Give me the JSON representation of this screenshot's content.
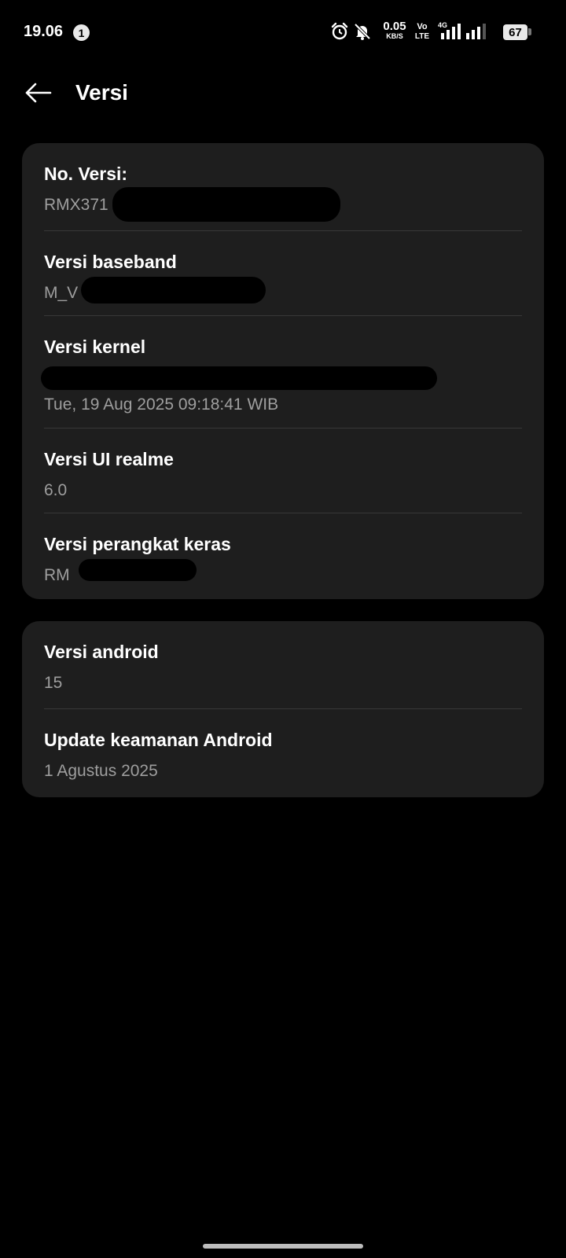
{
  "status_bar": {
    "time": "19.06",
    "notification_count": "1",
    "net_speed_value": "0.05",
    "net_speed_unit": "KB/S",
    "volte_top": "Vo",
    "volte_bottom": "LTE",
    "network_type": "4G",
    "battery_level": "67"
  },
  "header": {
    "title": "Versi"
  },
  "sections": [
    {
      "items": [
        {
          "label": "No. Versi:",
          "value": "RMX371"
        },
        {
          "label": "Versi baseband",
          "value": "M_V"
        },
        {
          "label": "Versi kernel",
          "value": "Tue, 19 Aug 2025 09:18:41 WIB"
        },
        {
          "label": "Versi UI realme",
          "value": "6.0"
        },
        {
          "label": "Versi perangkat keras",
          "value": "RM"
        }
      ]
    },
    {
      "items": [
        {
          "label": "Versi android",
          "value": "15"
        },
        {
          "label": "Update keamanan Android",
          "value": "1 Agustus 2025"
        }
      ]
    }
  ],
  "colors": {
    "background": "#000000",
    "card": "#1e1e1e",
    "label": "#ffffff",
    "value": "#9e9e9e",
    "divider": "#383838"
  }
}
